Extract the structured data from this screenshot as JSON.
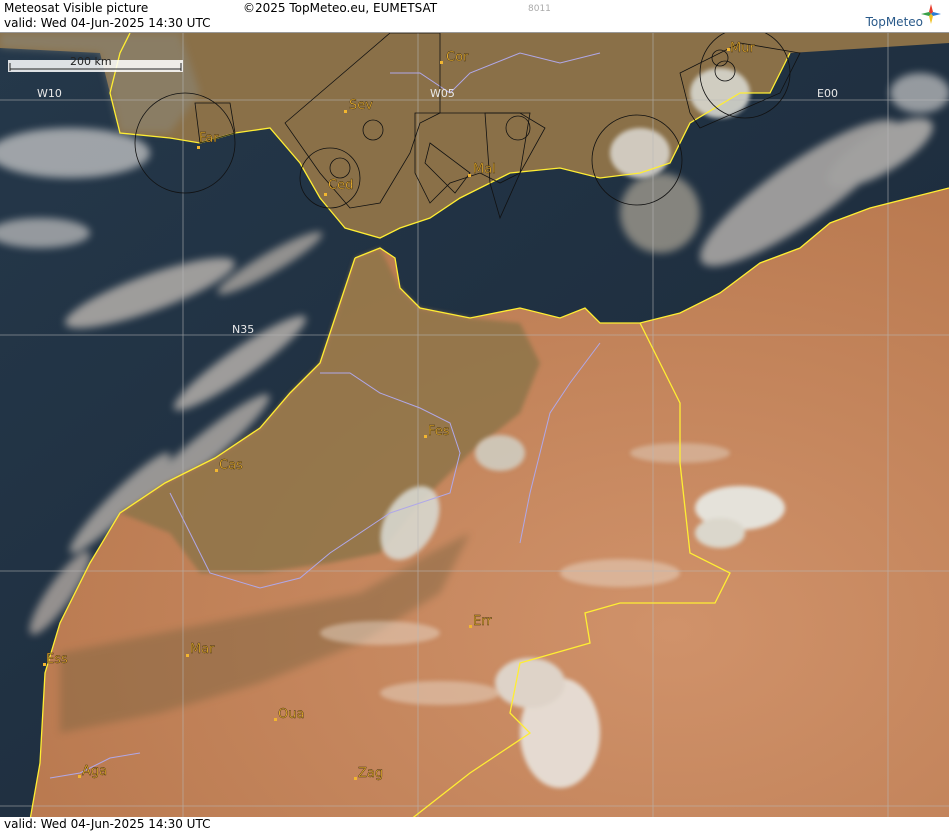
{
  "header": {
    "title": "Meteosat Visible picture",
    "valid": "valid:  Wed  04-Jun-2025  14:30 UTC",
    "copyright": "©2025 TopMeteo.eu, EUMETSAT",
    "code": "8011",
    "logo_text": "TopMeteo"
  },
  "footer": {
    "valid": "valid:  Wed  04-Jun-2025  14:30 UTC"
  },
  "map": {
    "scale_label": "200 km",
    "grid_labels": {
      "w10": "W10",
      "w05": "W05",
      "e00": "E00",
      "n35": "N35"
    },
    "cities": {
      "cor": "Cor",
      "mur": "Mur",
      "sev": "Sev",
      "far": "Far",
      "ced": "Ced",
      "mal": "Mal",
      "fes": "Fes",
      "cas": "Cas",
      "err": "Err",
      "ess": "Ess",
      "mar": "Mar",
      "oua": "Oua",
      "aga": "Aga",
      "zag": "Zag"
    },
    "colors": {
      "ocean": "#1a2a3a",
      "land_desert": "#c8875a",
      "land_green": "#8a7448",
      "coastline": "#ffee33",
      "border": "#b0a8e8",
      "city_label": "#f2b630",
      "grid": "#b8b8b8"
    }
  }
}
